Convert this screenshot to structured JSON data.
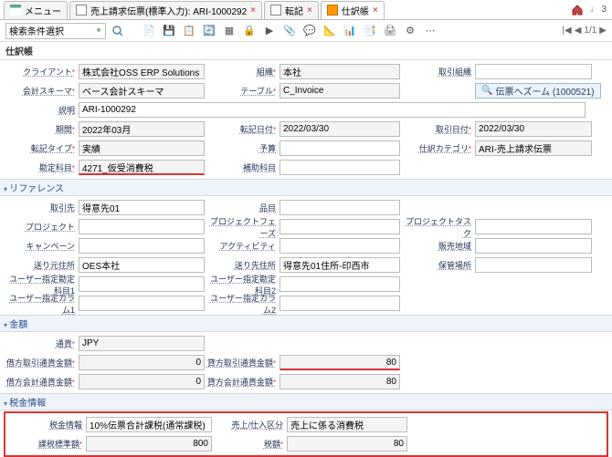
{
  "tabs": {
    "menu": "メニュー",
    "tab1": "売上請求伝票(標準入力): ARI-1000292",
    "tab2": "転記",
    "tab3": "仕訳帳"
  },
  "header_right": {
    "count_label": "3"
  },
  "toolbar": {
    "search_select": "検索条件選択",
    "pager": "1/1"
  },
  "form_title": "仕訳帳",
  "general": {
    "client_lbl": "クライアント",
    "client": "株式会社OSS ERP Solutions",
    "org_lbl": "組織",
    "org": "本社",
    "txnorg_lbl": "取引組織",
    "schema_lbl": "会計スキーマ",
    "schema": "ベース会計スキーマ",
    "table_lbl": "テーブル",
    "table": "C_Invoice",
    "zoom_lbl": "伝票へズーム (1000521)",
    "desc_lbl": "説明",
    "desc": "ARI-1000292",
    "period_lbl": "期間",
    "period": "2022年03月",
    "postdate_lbl": "転記日付",
    "postdate": "2022/03/30",
    "txndate_lbl": "取引日付",
    "txndate": "2022/03/30",
    "posttype_lbl": "転記タイプ",
    "posttype": "実績",
    "budget_lbl": "予算",
    "journalcat_lbl": "仕訳カテゴリ",
    "journalcat": "ARI-売上請求伝票",
    "account_lbl": "勘定科目",
    "account": "4271_仮受消費税",
    "subacct_lbl": "補助科目"
  },
  "ref_title": "リファレンス",
  "ref": {
    "bpart_lbl": "取引先",
    "bpart": "得意先01",
    "product_lbl": "品目",
    "project_lbl": "プロジェクト",
    "phase_lbl": "プロジェクトフェーズ",
    "task_lbl": "プロジェクトタスク",
    "campaign_lbl": "キャンペーン",
    "activity_lbl": "アクティビティ",
    "region_lbl": "販売地域",
    "locfrom_lbl": "送り元住所",
    "locfrom": "OES本社",
    "locto_lbl": "送り先住所",
    "locto": "得意先01住所-印西市",
    "whloc_lbl": "保管場所",
    "ud1_lbl": "ユーザー指定勘定科目1",
    "ud2_lbl": "ユーザー指定勘定科目2",
    "uc1_lbl": "ユーザー指定カラム1",
    "uc2_lbl": "ユーザー指定カラム2"
  },
  "amt_title": "金額",
  "amt": {
    "currency_lbl": "通貨",
    "currency": "JPY",
    "dr_src_lbl": "借方取引通貨金額",
    "dr_src": "0",
    "cr_src_lbl": "貸方取引通貨金額",
    "cr_src": "80",
    "dr_acc_lbl": "借方会計通貨金額",
    "dr_acc": "0",
    "cr_acc_lbl": "貸方会計通貨金額",
    "cr_acc": "80"
  },
  "tax_title": "税金情報",
  "tax": {
    "taxinfo_lbl": "税金情報",
    "taxinfo": "10%伝票合計課税(通常課税)",
    "soporeg_lbl": "売上/仕入区分",
    "soporeg": "売上に係る消費税",
    "taxbase_lbl": "課税標準額",
    "taxbase": "800",
    "taxamt_lbl": "税額",
    "taxamt": "80"
  }
}
